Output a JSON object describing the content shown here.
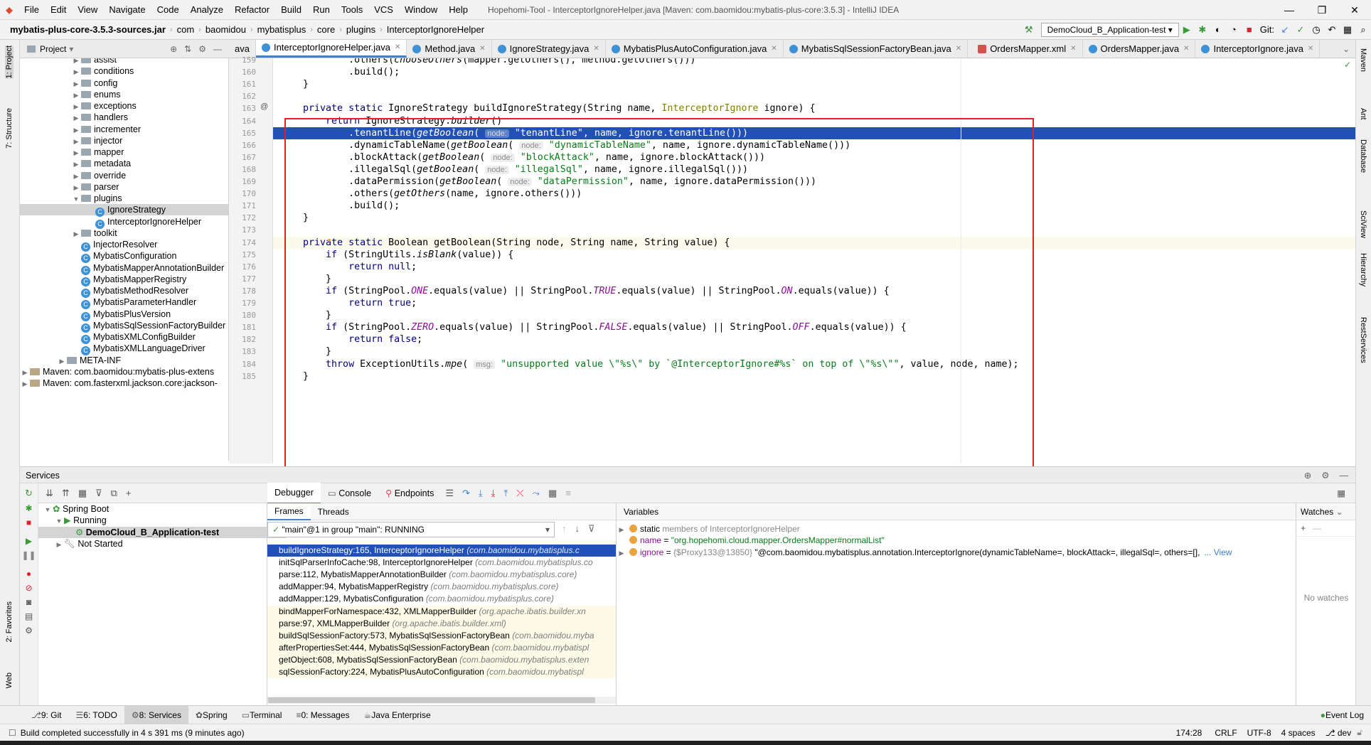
{
  "menu": {
    "items": [
      "File",
      "Edit",
      "View",
      "Navigate",
      "Code",
      "Analyze",
      "Refactor",
      "Build",
      "Run",
      "Tools",
      "VCS",
      "Window",
      "Help"
    ],
    "title": "Hopehomi-Tool - InterceptorIgnoreHelper.java [Maven: com.baomidou:mybatis-plus-core:3.5.3] - IntelliJ IDEA"
  },
  "nav": {
    "crumbs": [
      "mybatis-plus-core-3.5.3-sources.jar",
      "com",
      "baomidou",
      "mybatisplus",
      "core",
      "plugins",
      "InterceptorIgnoreHelper"
    ],
    "run_config": "DemoCloud_B_Application-test",
    "git_label": "Git:"
  },
  "project": {
    "title": "Project",
    "rows": [
      {
        "label": "assist",
        "kind": "folder",
        "depth": 3
      },
      {
        "label": "conditions",
        "kind": "folder",
        "depth": 3
      },
      {
        "label": "config",
        "kind": "folder",
        "depth": 3
      },
      {
        "label": "enums",
        "kind": "folder",
        "depth": 3
      },
      {
        "label": "exceptions",
        "kind": "folder",
        "depth": 3
      },
      {
        "label": "handlers",
        "kind": "folder",
        "depth": 3
      },
      {
        "label": "incrementer",
        "kind": "folder",
        "depth": 3
      },
      {
        "label": "injector",
        "kind": "folder",
        "depth": 3
      },
      {
        "label": "mapper",
        "kind": "folder",
        "depth": 3
      },
      {
        "label": "metadata",
        "kind": "folder",
        "depth": 3
      },
      {
        "label": "override",
        "kind": "folder",
        "depth": 3
      },
      {
        "label": "parser",
        "kind": "folder",
        "depth": 3
      },
      {
        "label": "plugins",
        "kind": "folder-open",
        "depth": 3
      },
      {
        "label": "IgnoreStrategy",
        "kind": "class",
        "depth": 4,
        "selected": true
      },
      {
        "label": "InterceptorIgnoreHelper",
        "kind": "class",
        "depth": 4
      },
      {
        "label": "toolkit",
        "kind": "folder",
        "depth": 3
      },
      {
        "label": "InjectorResolver",
        "kind": "class",
        "depth": 3
      },
      {
        "label": "MybatisConfiguration",
        "kind": "class",
        "depth": 3
      },
      {
        "label": "MybatisMapperAnnotationBuilder",
        "kind": "class",
        "depth": 3
      },
      {
        "label": "MybatisMapperRegistry",
        "kind": "class",
        "depth": 3
      },
      {
        "label": "MybatisMethodResolver",
        "kind": "class",
        "depth": 3
      },
      {
        "label": "MybatisParameterHandler",
        "kind": "class",
        "depth": 3
      },
      {
        "label": "MybatisPlusVersion",
        "kind": "class",
        "depth": 3
      },
      {
        "label": "MybatisSqlSessionFactoryBuilder",
        "kind": "class",
        "depth": 3
      },
      {
        "label": "MybatisXMLConfigBuilder",
        "kind": "class",
        "depth": 3
      },
      {
        "label": "MybatisXMLLanguageDriver",
        "kind": "class",
        "depth": 3
      },
      {
        "label": "META-INF",
        "kind": "folder",
        "depth": 2
      },
      {
        "label": "Maven: com.baomidou:mybatis-plus-extens",
        "kind": "lib",
        "depth": 0
      },
      {
        "label": "Maven: com.fasterxml.jackson.core:jackson-",
        "kind": "lib",
        "depth": 0
      }
    ]
  },
  "tabs": [
    {
      "label": "ava",
      "icon": "none"
    },
    {
      "label": "InterceptorIgnoreHelper.java",
      "icon": "class",
      "active": true
    },
    {
      "label": "Method.java",
      "icon": "class"
    },
    {
      "label": "IgnoreStrategy.java",
      "icon": "class"
    },
    {
      "label": "MybatisPlusAutoConfiguration.java",
      "icon": "class"
    },
    {
      "label": "MybatisSqlSessionFactoryBean.java",
      "icon": "class"
    },
    {
      "label": "OrdersMapper.xml",
      "icon": "xml"
    },
    {
      "label": "OrdersMapper.java",
      "icon": "class"
    },
    {
      "label": "InterceptorIgnore.java",
      "icon": "class"
    }
  ],
  "editor": {
    "lines": [
      {
        "n": "159",
        "segs": [
          [
            "",
            "            .others("
          ],
          [
            "it",
            "chooseOthers"
          ],
          [
            "",
            "(mapper.getOthers(), method.getOthers()))"
          ]
        ]
      },
      {
        "n": "160",
        "segs": [
          [
            "",
            "            .build();"
          ]
        ]
      },
      {
        "n": "161",
        "segs": [
          [
            "",
            "    }"
          ]
        ]
      },
      {
        "n": "162",
        "segs": []
      },
      {
        "n": "163",
        "segs": [
          [
            "kw",
            "    private static "
          ],
          [
            "",
            "IgnoreStrategy "
          ],
          [
            "",
            "buildIgnoreStrategy(String name, "
          ],
          [
            "ann",
            "InterceptorIgnore"
          ],
          [
            "",
            " ignore) {"
          ]
        ]
      },
      {
        "n": "164",
        "segs": [
          [
            "kw",
            "        return "
          ],
          [
            "",
            "IgnoreStrategy."
          ],
          [
            "it",
            "builder"
          ],
          [
            "",
            "()"
          ]
        ]
      },
      {
        "n": "165",
        "hl": true,
        "segs": [
          [
            "",
            "            .tenantLine("
          ],
          [
            "it",
            "getBoolean"
          ],
          [
            "",
            "( "
          ],
          [
            "hint",
            "node:"
          ],
          [
            "str",
            " \"tenantLine\""
          ],
          [
            "",
            ", name, ignore.tenantLine()))"
          ]
        ]
      },
      {
        "n": "166",
        "segs": [
          [
            "",
            "            .dynamicTableName("
          ],
          [
            "it",
            "getBoolean"
          ],
          [
            "",
            "( "
          ],
          [
            "hint",
            "node:"
          ],
          [
            "str",
            " \"dynamicTableName\""
          ],
          [
            "",
            ", name, ignore.dynamicTableName()))"
          ]
        ]
      },
      {
        "n": "167",
        "segs": [
          [
            "",
            "            .blockAttack("
          ],
          [
            "it",
            "getBoolean"
          ],
          [
            "",
            "( "
          ],
          [
            "hint",
            "node:"
          ],
          [
            "str",
            " \"blockAttack\""
          ],
          [
            "",
            ", name, ignore.blockAttack()))"
          ]
        ]
      },
      {
        "n": "168",
        "segs": [
          [
            "",
            "            .illegalSql("
          ],
          [
            "it",
            "getBoolean"
          ],
          [
            "",
            "( "
          ],
          [
            "hint",
            "node:"
          ],
          [
            "str",
            " \"illegalSql\""
          ],
          [
            "",
            ", name, ignore.illegalSql()))"
          ]
        ]
      },
      {
        "n": "169",
        "segs": [
          [
            "",
            "            .dataPermission("
          ],
          [
            "it",
            "getBoolean"
          ],
          [
            "",
            "( "
          ],
          [
            "hint",
            "node:"
          ],
          [
            "str",
            " \"dataPermission\""
          ],
          [
            "",
            ", name, ignore.dataPermission()))"
          ]
        ]
      },
      {
        "n": "170",
        "segs": [
          [
            "",
            "            .others("
          ],
          [
            "it",
            "getOthers"
          ],
          [
            "",
            "(name, ignore.others()))"
          ]
        ]
      },
      {
        "n": "171",
        "segs": [
          [
            "",
            "            .build();"
          ]
        ]
      },
      {
        "n": "172",
        "segs": [
          [
            "",
            "    }"
          ]
        ]
      },
      {
        "n": "173",
        "segs": []
      },
      {
        "n": "174",
        "cur": true,
        "segs": [
          [
            "kw",
            "    private static "
          ],
          [
            "",
            "Boolean getBoolean(String node, String name, String value) {"
          ]
        ]
      },
      {
        "n": "175",
        "segs": [
          [
            "kw",
            "        if "
          ],
          [
            "",
            "(StringUtils."
          ],
          [
            "it",
            "isBlank"
          ],
          [
            "",
            "(value)) {"
          ]
        ]
      },
      {
        "n": "176",
        "segs": [
          [
            "kw",
            "            return null"
          ],
          [
            "",
            ";"
          ]
        ]
      },
      {
        "n": "177",
        "segs": [
          [
            "",
            "        }"
          ]
        ]
      },
      {
        "n": "178",
        "segs": [
          [
            "kw",
            "        if "
          ],
          [
            "",
            "(StringPool."
          ],
          [
            "cst",
            "ONE"
          ],
          [
            "",
            ".equals(value) || StringPool."
          ],
          [
            "cst",
            "TRUE"
          ],
          [
            "",
            ".equals(value) || StringPool."
          ],
          [
            "cst",
            "ON"
          ],
          [
            "",
            ".equals(value)) {"
          ]
        ]
      },
      {
        "n": "179",
        "segs": [
          [
            "kw",
            "            return true"
          ],
          [
            "",
            ";"
          ]
        ]
      },
      {
        "n": "180",
        "segs": [
          [
            "",
            "        }"
          ]
        ]
      },
      {
        "n": "181",
        "segs": [
          [
            "kw",
            "        if "
          ],
          [
            "",
            "(StringPool."
          ],
          [
            "cst",
            "ZERO"
          ],
          [
            "",
            ".equals(value) || StringPool."
          ],
          [
            "cst",
            "FALSE"
          ],
          [
            "",
            ".equals(value) || StringPool."
          ],
          [
            "cst",
            "OFF"
          ],
          [
            "",
            ".equals(value)) {"
          ]
        ]
      },
      {
        "n": "182",
        "segs": [
          [
            "kw",
            "            return false"
          ],
          [
            "",
            ";"
          ]
        ]
      },
      {
        "n": "183",
        "segs": [
          [
            "",
            "        }"
          ]
        ]
      },
      {
        "n": "184",
        "segs": [
          [
            "kw",
            "        throw "
          ],
          [
            "",
            "ExceptionUtils."
          ],
          [
            "it",
            "mpe"
          ],
          [
            "",
            "( "
          ],
          [
            "hint",
            "msg:"
          ],
          [
            "str",
            " \"unsupported value \\\"%s\\\" by `@InterceptorIgnore#%s` on top of \\\"%s\\\"\""
          ],
          [
            "",
            ", value, node, name);"
          ]
        ]
      },
      {
        "n": "185",
        "segs": [
          [
            "",
            "    }"
          ]
        ]
      }
    ]
  },
  "services": {
    "title": "Services",
    "tree": [
      {
        "label": "Spring Boot",
        "depth": 0
      },
      {
        "label": "Running",
        "depth": 1
      },
      {
        "label": "DemoCloud_B_Application-test",
        "depth": 2,
        "selected": true
      },
      {
        "label": "Not Started",
        "depth": 1
      }
    ]
  },
  "debugger": {
    "tabs": [
      "Debugger",
      "Console",
      "Endpoints"
    ],
    "frames_tab": "Frames",
    "threads_tab": "Threads",
    "thread": "\"main\"@1 in group \"main\": RUNNING",
    "frames": [
      {
        "m": "buildIgnoreStrategy:165, InterceptorIgnoreHelper",
        "p": "(com.baomidou.mybatisplus.c",
        "sel": true
      },
      {
        "m": "initSqlParserInfoCache:98, InterceptorIgnoreHelper",
        "p": "(com.baomidou.mybatisplus.co"
      },
      {
        "m": "parse:112, MybatisMapperAnnotationBuilder",
        "p": "(com.baomidou.mybatisplus.core)"
      },
      {
        "m": "addMapper:94, MybatisMapperRegistry",
        "p": "(com.baomidou.mybatisplus.core)"
      },
      {
        "m": "addMapper:129, MybatisConfiguration",
        "p": "(com.baomidou.mybatisplus.core)"
      },
      {
        "m": "bindMapperForNamespace:432, XMLMapperBuilder",
        "p": "(org.apache.ibatis.builder.xn",
        "lib": true
      },
      {
        "m": "parse:97, XMLMapperBuilder",
        "p": "(org.apache.ibatis.builder.xml)",
        "lib": true
      },
      {
        "m": "buildSqlSessionFactory:573, MybatisSqlSessionFactoryBean",
        "p": "(com.baomidou.myba",
        "lib": true
      },
      {
        "m": "afterPropertiesSet:444, MybatisSqlSessionFactoryBean",
        "p": "(com.baomidou.mybatispl",
        "lib": true
      },
      {
        "m": "getObject:608, MybatisSqlSessionFactoryBean",
        "p": "(com.baomidou.mybatisplus.exten",
        "lib": true
      },
      {
        "m": "sqlSessionFactory:224, MybatisPlusAutoConfiguration",
        "p": "(com.baomidou.mybatispl",
        "lib": true
      }
    ],
    "variables_title": "Variables",
    "vars": [
      {
        "pre": "static",
        "text": " members of InterceptorIgnoreHelper"
      },
      {
        "name": "name",
        "eq": " = ",
        "val": "\"org.hopehomi.cloud.mapper.OrdersMapper#normalList\""
      },
      {
        "name": "ignore",
        "eq": " = ",
        "gray": "{$Proxy133@13850} ",
        "val2": "\"@com.baomidou.mybatisplus.annotation.InterceptorIgnore(dynamicTableName=, blockAttack=, illegalSql=, others=[],",
        "more": "... View"
      }
    ],
    "watches_title": "Watches",
    "no_watches": "No watches"
  },
  "toolwindows": [
    "9: Git",
    "6: TODO",
    "8: Services",
    "Spring",
    "Terminal",
    "0: Messages",
    "Java Enterprise"
  ],
  "event_log": "Event Log",
  "status": {
    "message": "Build completed successfully in 4 s 391 ms (9 minutes ago)",
    "pos": "174:28",
    "crlf": "CRLF",
    "enc": "UTF-8",
    "indent": "4 spaces",
    "branch": "dev"
  },
  "left_stripe": [
    "1: Project",
    "7: Structure",
    "2: Favorites",
    "Web"
  ],
  "right_stripe": [
    "Maven",
    "Ant",
    "Database",
    "SciView",
    "Hierarchy",
    "RestServices"
  ]
}
